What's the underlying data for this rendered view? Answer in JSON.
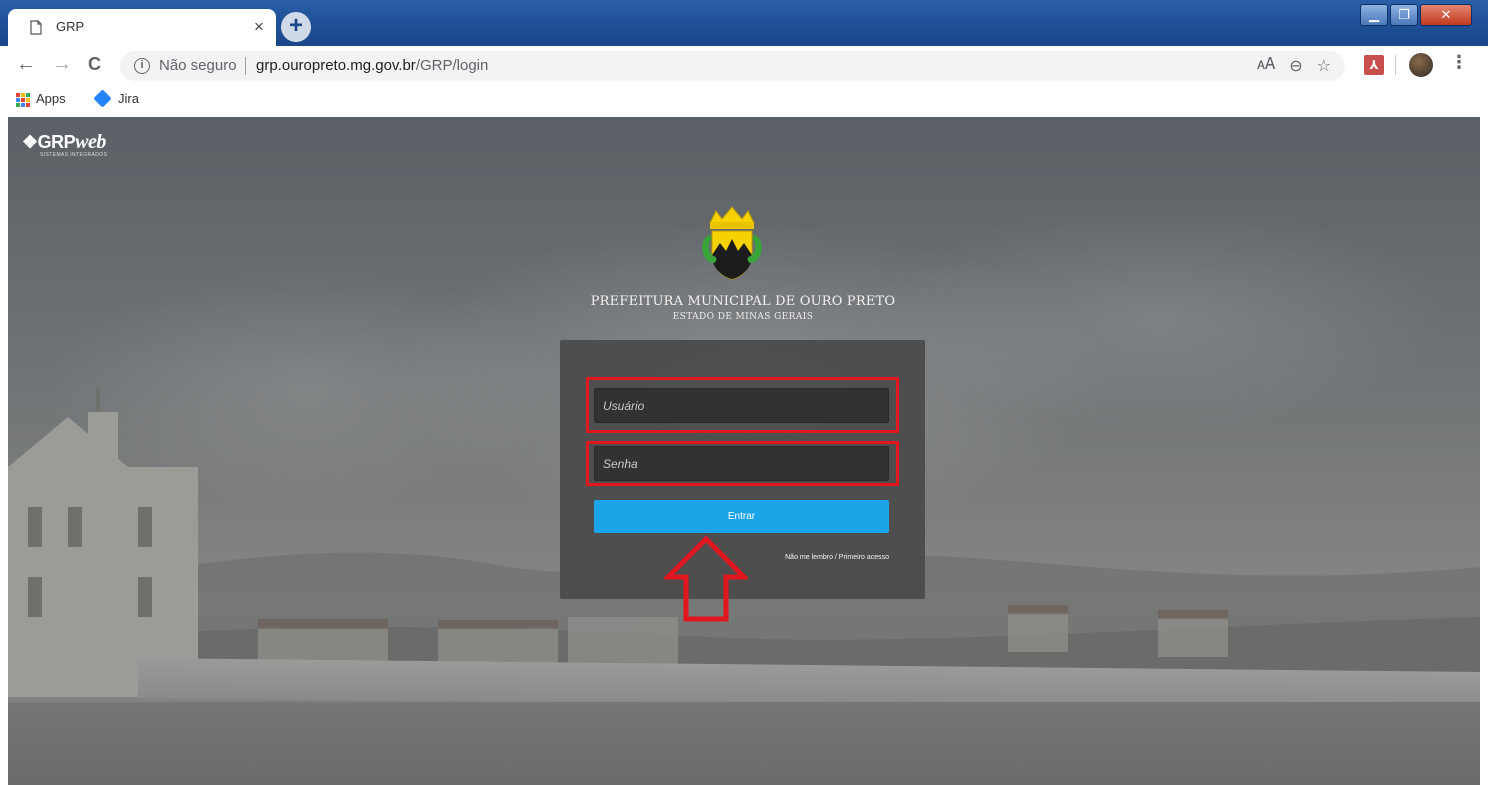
{
  "browser": {
    "tab_title": "GRP",
    "tab_close": "×",
    "new_tab": "+",
    "nav_back": "←",
    "nav_forward": "→",
    "nav_reload": "C",
    "security_label": "Não seguro",
    "url_host": "grp.ouropreto.mg.gov.br",
    "url_path": "/GRP/login",
    "window_controls": [
      "minimize",
      "maximize",
      "close"
    ]
  },
  "bookmarks": [
    {
      "label": "Apps",
      "icon": "apps-grid-icon"
    },
    {
      "label": "Jira",
      "icon": "jira-icon"
    }
  ],
  "brand": {
    "logo_text": "GRP",
    "logo_text_italic": "web",
    "logo_subtitle": "SISTEMAS INTEGRADOS"
  },
  "header": {
    "title": "PREFEITURA MUNICIPAL DE OURO PRETO",
    "subtitle": "ESTADO DE MINAS GERAIS"
  },
  "login": {
    "username_placeholder": "Usuário",
    "username_value": "",
    "password_placeholder": "Senha",
    "password_value": "",
    "submit_label": "Entrar",
    "forgot_label": "Não me lembro / Primeiro acesso"
  },
  "colors": {
    "highlight": "#e0171f",
    "button": "#1ba4e8",
    "panel": "#4a4a4a",
    "chrome_titlebar": "#1f4f96"
  }
}
